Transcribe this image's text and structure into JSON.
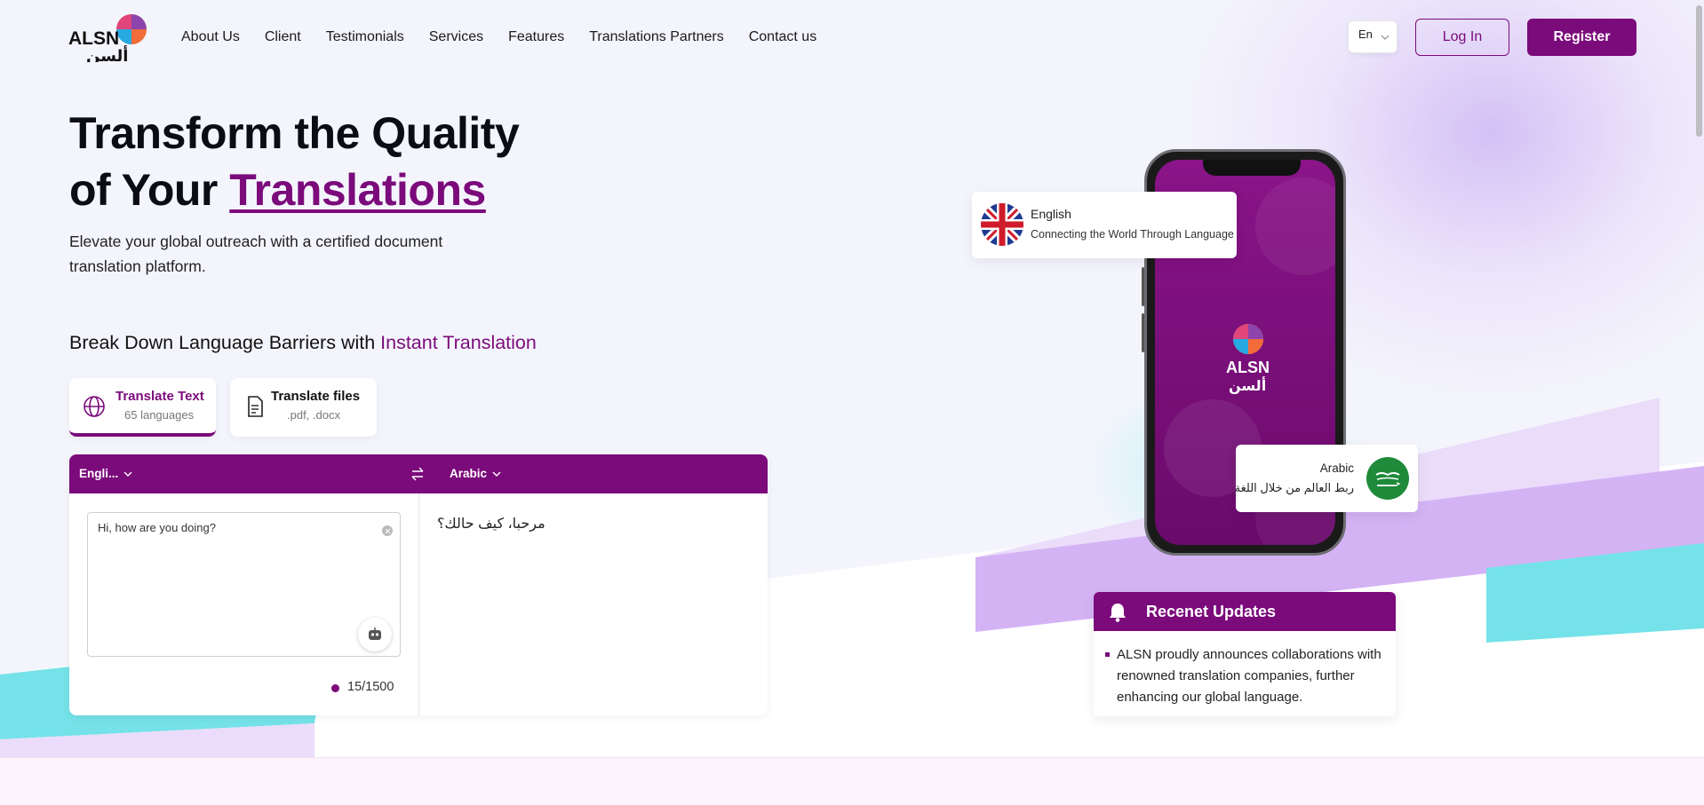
{
  "header": {
    "logo_text": "ALSN",
    "logo_arabic": "ألسن",
    "nav": [
      "About Us",
      "Client",
      "Testimonials",
      "Services",
      "Features",
      "Translations Partners",
      "Contact us"
    ],
    "language": "En",
    "login_label": "Log In",
    "register_label": "Register"
  },
  "hero": {
    "title_line1": "Transform the Quality",
    "title_line2_prefix": "of Your ",
    "title_highlight": "Translations",
    "subtitle": "Elevate your global outreach with a certified document translation platform."
  },
  "translator": {
    "heading_prefix": "Break Down Language Barriers with ",
    "heading_accent": "Instant Translation",
    "tabs": [
      {
        "title": "Translate Text",
        "subtitle": "65 languages"
      },
      {
        "title": "Translate files",
        "subtitle": ".pdf, .docx"
      }
    ],
    "source_language": "Engli...",
    "target_language": "Arabic",
    "input_text": "Hi, how are you doing?",
    "output_text": "مرحبا، كيف حالك؟",
    "char_count": "15/1500"
  },
  "phone_cards": {
    "english": {
      "name": "English",
      "tagline": "Connecting the World Through Language"
    },
    "arabic": {
      "name": "Arabic",
      "tagline": "ربط العالم من خلال اللغة"
    }
  },
  "updates": {
    "title": "Recenet Updates",
    "items": [
      "ALSN proudly announces collaborations with renowned translation companies, further enhancing our global language."
    ]
  },
  "colors": {
    "brand": "#7b0a7b",
    "accent_cyan": "#6fe3e8",
    "accent_lilac": "#d2b2f4"
  }
}
